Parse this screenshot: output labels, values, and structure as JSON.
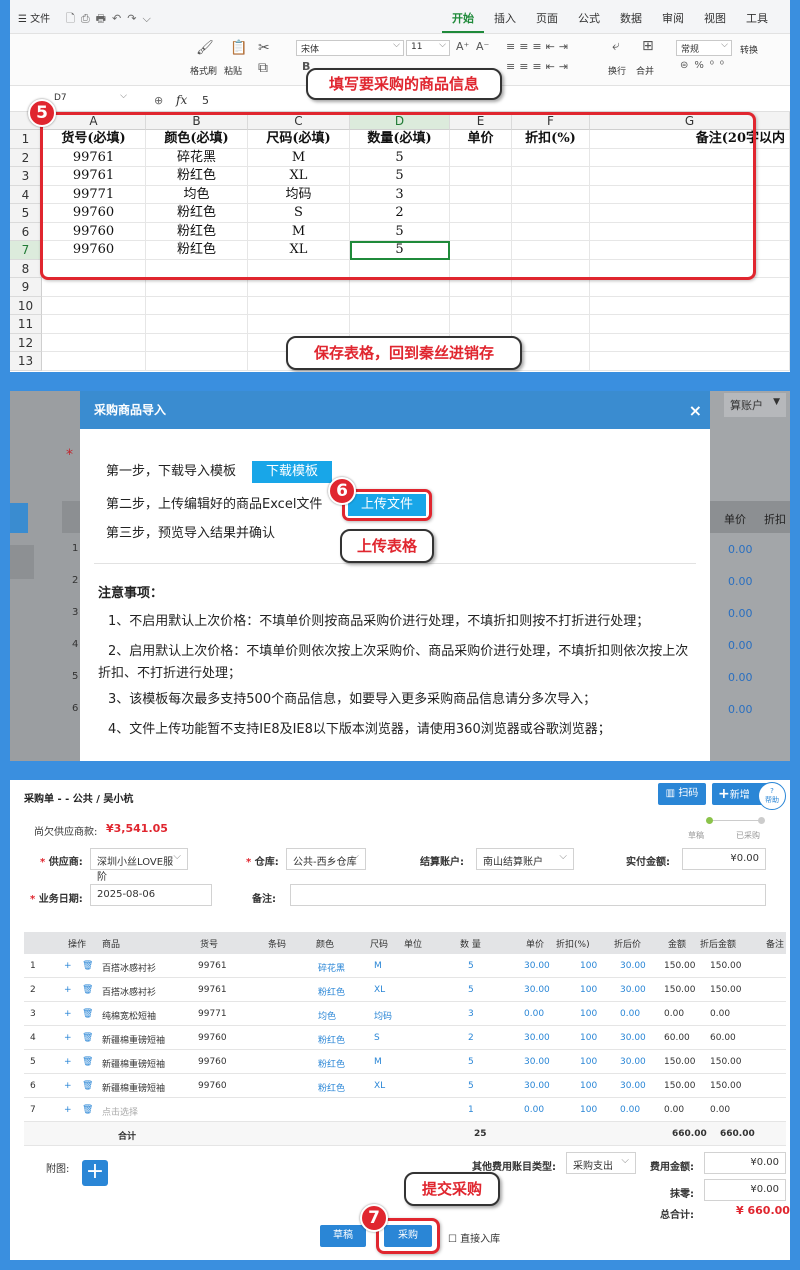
{
  "panel1": {
    "menu": {
      "file": "文件",
      "tabs": [
        "开始",
        "插入",
        "页面",
        "公式",
        "数据",
        "审阅",
        "视图",
        "工具"
      ],
      "active_tab": "开始"
    },
    "ribbon": {
      "format_painter": "格式刷",
      "paste": "粘贴",
      "font": "宋体",
      "font_size": "11",
      "wrap": "换行",
      "merge": "合并",
      "number_format": "常规",
      "convert": "转换"
    },
    "formula_bar": {
      "cell_ref": "D7",
      "fx": "fx",
      "value": "5"
    },
    "columns": [
      "A",
      "B",
      "C",
      "D",
      "E",
      "F",
      "G"
    ],
    "rows": [
      "1",
      "2",
      "3",
      "4",
      "5",
      "6",
      "7",
      "8",
      "9",
      "10",
      "11",
      "12",
      "13"
    ],
    "header": [
      "货号(必填)",
      "颜色(必填)",
      "尺码(必填)",
      "数量(必填)",
      "单价",
      "折扣(%)",
      "备注(20字以内"
    ],
    "data": [
      [
        "99761",
        "碎花黑",
        "M",
        "5"
      ],
      [
        "99761",
        "粉红色",
        "XL",
        "5"
      ],
      [
        "99771",
        "均色",
        "均码",
        "3"
      ],
      [
        "99760",
        "粉红色",
        "S",
        "2"
      ],
      [
        "99760",
        "粉红色",
        "M",
        "5"
      ],
      [
        "99760",
        "粉红色",
        "XL",
        "5"
      ]
    ],
    "step_number": "5",
    "callout_top": "填写要采购的商品信息",
    "callout_bottom": "保存表格，回到秦丝进销存"
  },
  "panel2": {
    "bg_account": "算账户",
    "bg_headers": [
      "单价",
      "折扣"
    ],
    "bg_rows": [
      "1",
      "2",
      "3",
      "4",
      "5",
      "6"
    ],
    "bg_values": [
      "0.00",
      "0.00",
      "0.00",
      "0.00",
      "0.00",
      "0.00"
    ],
    "dialog_title": "采购商品导入",
    "close": "×",
    "step1": "第一步，下载导入模板",
    "download_btn": "下载模板",
    "step2": "第二步，上传编辑好的商品Excel文件",
    "upload_btn": "上传文件",
    "step3": "第三步，预览导入结果并确认",
    "step_number": "6",
    "callout": "上传表格",
    "notes_title": "注意事项：",
    "notes": [
      "1、不启用默认上次价格：不填单价则按商品采购价进行处理，不填折扣则按不打折进行处理；",
      "2、启用默认上次价格：不填单价则依次按上次采购价、商品采购价进行处理，不填折扣则依次按上次折扣、不打折进行处理；",
      "3、该模板每次最多支持500个商品信息，如要导入更多采购商品信息请分多次导入；",
      "4、文件上传功能暂不支持IE8及IE8以下版本浏览器，请使用360浏览器或谷歌浏览器；"
    ]
  },
  "panel3": {
    "title": "采购单 - - 公共 / 吴小杭",
    "scan_btn": "扫码",
    "new_btn": "新增",
    "help": "帮助",
    "debt_label": "尚欠供应商款:",
    "debt_value": "¥3,541.05",
    "progress": [
      "草稿",
      "已采购"
    ],
    "supplier_label": "供应商:",
    "supplier_value": "深圳小丝LOVE服阶",
    "warehouse_label": "仓库:",
    "warehouse_value": "公共-西乡仓库",
    "account_label": "结算账户:",
    "account_value": "南山结算账户",
    "paid_label": "实付金额:",
    "paid_value": "¥0.00",
    "date_label": "业务日期:",
    "date_value": "2025-08-06",
    "remark_label": "备注:",
    "table_headers": [
      "操作",
      "商品",
      "货号",
      "条码",
      "颜色",
      "尺码",
      "单位",
      "数 量",
      "单价",
      "折扣(%)",
      "折后价",
      "金额",
      "折后金额",
      "备注"
    ],
    "rows": [
      {
        "no": "1",
        "name": "百搭冰感衬衫",
        "code": "99761",
        "color": "碎花黑",
        "size": "M",
        "qty": "5",
        "price": "30.00",
        "disc": "100",
        "dprice": "30.00",
        "amount": "150.00",
        "damount": "150.00"
      },
      {
        "no": "2",
        "name": "百搭冰感衬衫",
        "code": "99761",
        "color": "粉红色",
        "size": "XL",
        "qty": "5",
        "price": "30.00",
        "disc": "100",
        "dprice": "30.00",
        "amount": "150.00",
        "damount": "150.00"
      },
      {
        "no": "3",
        "name": "纯棉宽松短袖",
        "code": "99771",
        "color": "均色",
        "size": "均码",
        "qty": "3",
        "price": "0.00",
        "disc": "100",
        "dprice": "0.00",
        "amount": "0.00",
        "damount": "0.00"
      },
      {
        "no": "4",
        "name": "新疆棉重磅短袖",
        "code": "99760",
        "color": "粉红色",
        "size": "S",
        "qty": "2",
        "price": "30.00",
        "disc": "100",
        "dprice": "30.00",
        "amount": "60.00",
        "damount": "60.00"
      },
      {
        "no": "5",
        "name": "新疆棉重磅短袖",
        "code": "99760",
        "color": "粉红色",
        "size": "M",
        "qty": "5",
        "price": "30.00",
        "disc": "100",
        "dprice": "30.00",
        "amount": "150.00",
        "damount": "150.00"
      },
      {
        "no": "6",
        "name": "新疆棉重磅短袖",
        "code": "99760",
        "color": "粉红色",
        "size": "XL",
        "qty": "5",
        "price": "30.00",
        "disc": "100",
        "dprice": "30.00",
        "amount": "150.00",
        "damount": "150.00"
      }
    ],
    "placeholder_row": {
      "no": "7",
      "name": "点击选择",
      "qty": "1",
      "price": "0.00",
      "disc": "100",
      "dprice": "0.00",
      "amount": "0.00",
      "damount": "0.00"
    },
    "total_row": {
      "label": "合计",
      "qty": "25",
      "amount": "660.00",
      "damount": "660.00"
    },
    "attach_label": "附图:",
    "fee_type_label": "其他费用账目类型:",
    "fee_type_value": "采购支出",
    "fee_amount_label": "费用金额:",
    "fee_amount_value": "¥0.00",
    "rounding_label": "抹零:",
    "rounding_value": "¥0.00",
    "total_label": "总合计:",
    "total_value": "¥ 660.00",
    "draft_btn": "草稿",
    "purchase_btn": "采购",
    "direct_in": "直接入库",
    "step_number": "7",
    "callout": "提交采购"
  }
}
